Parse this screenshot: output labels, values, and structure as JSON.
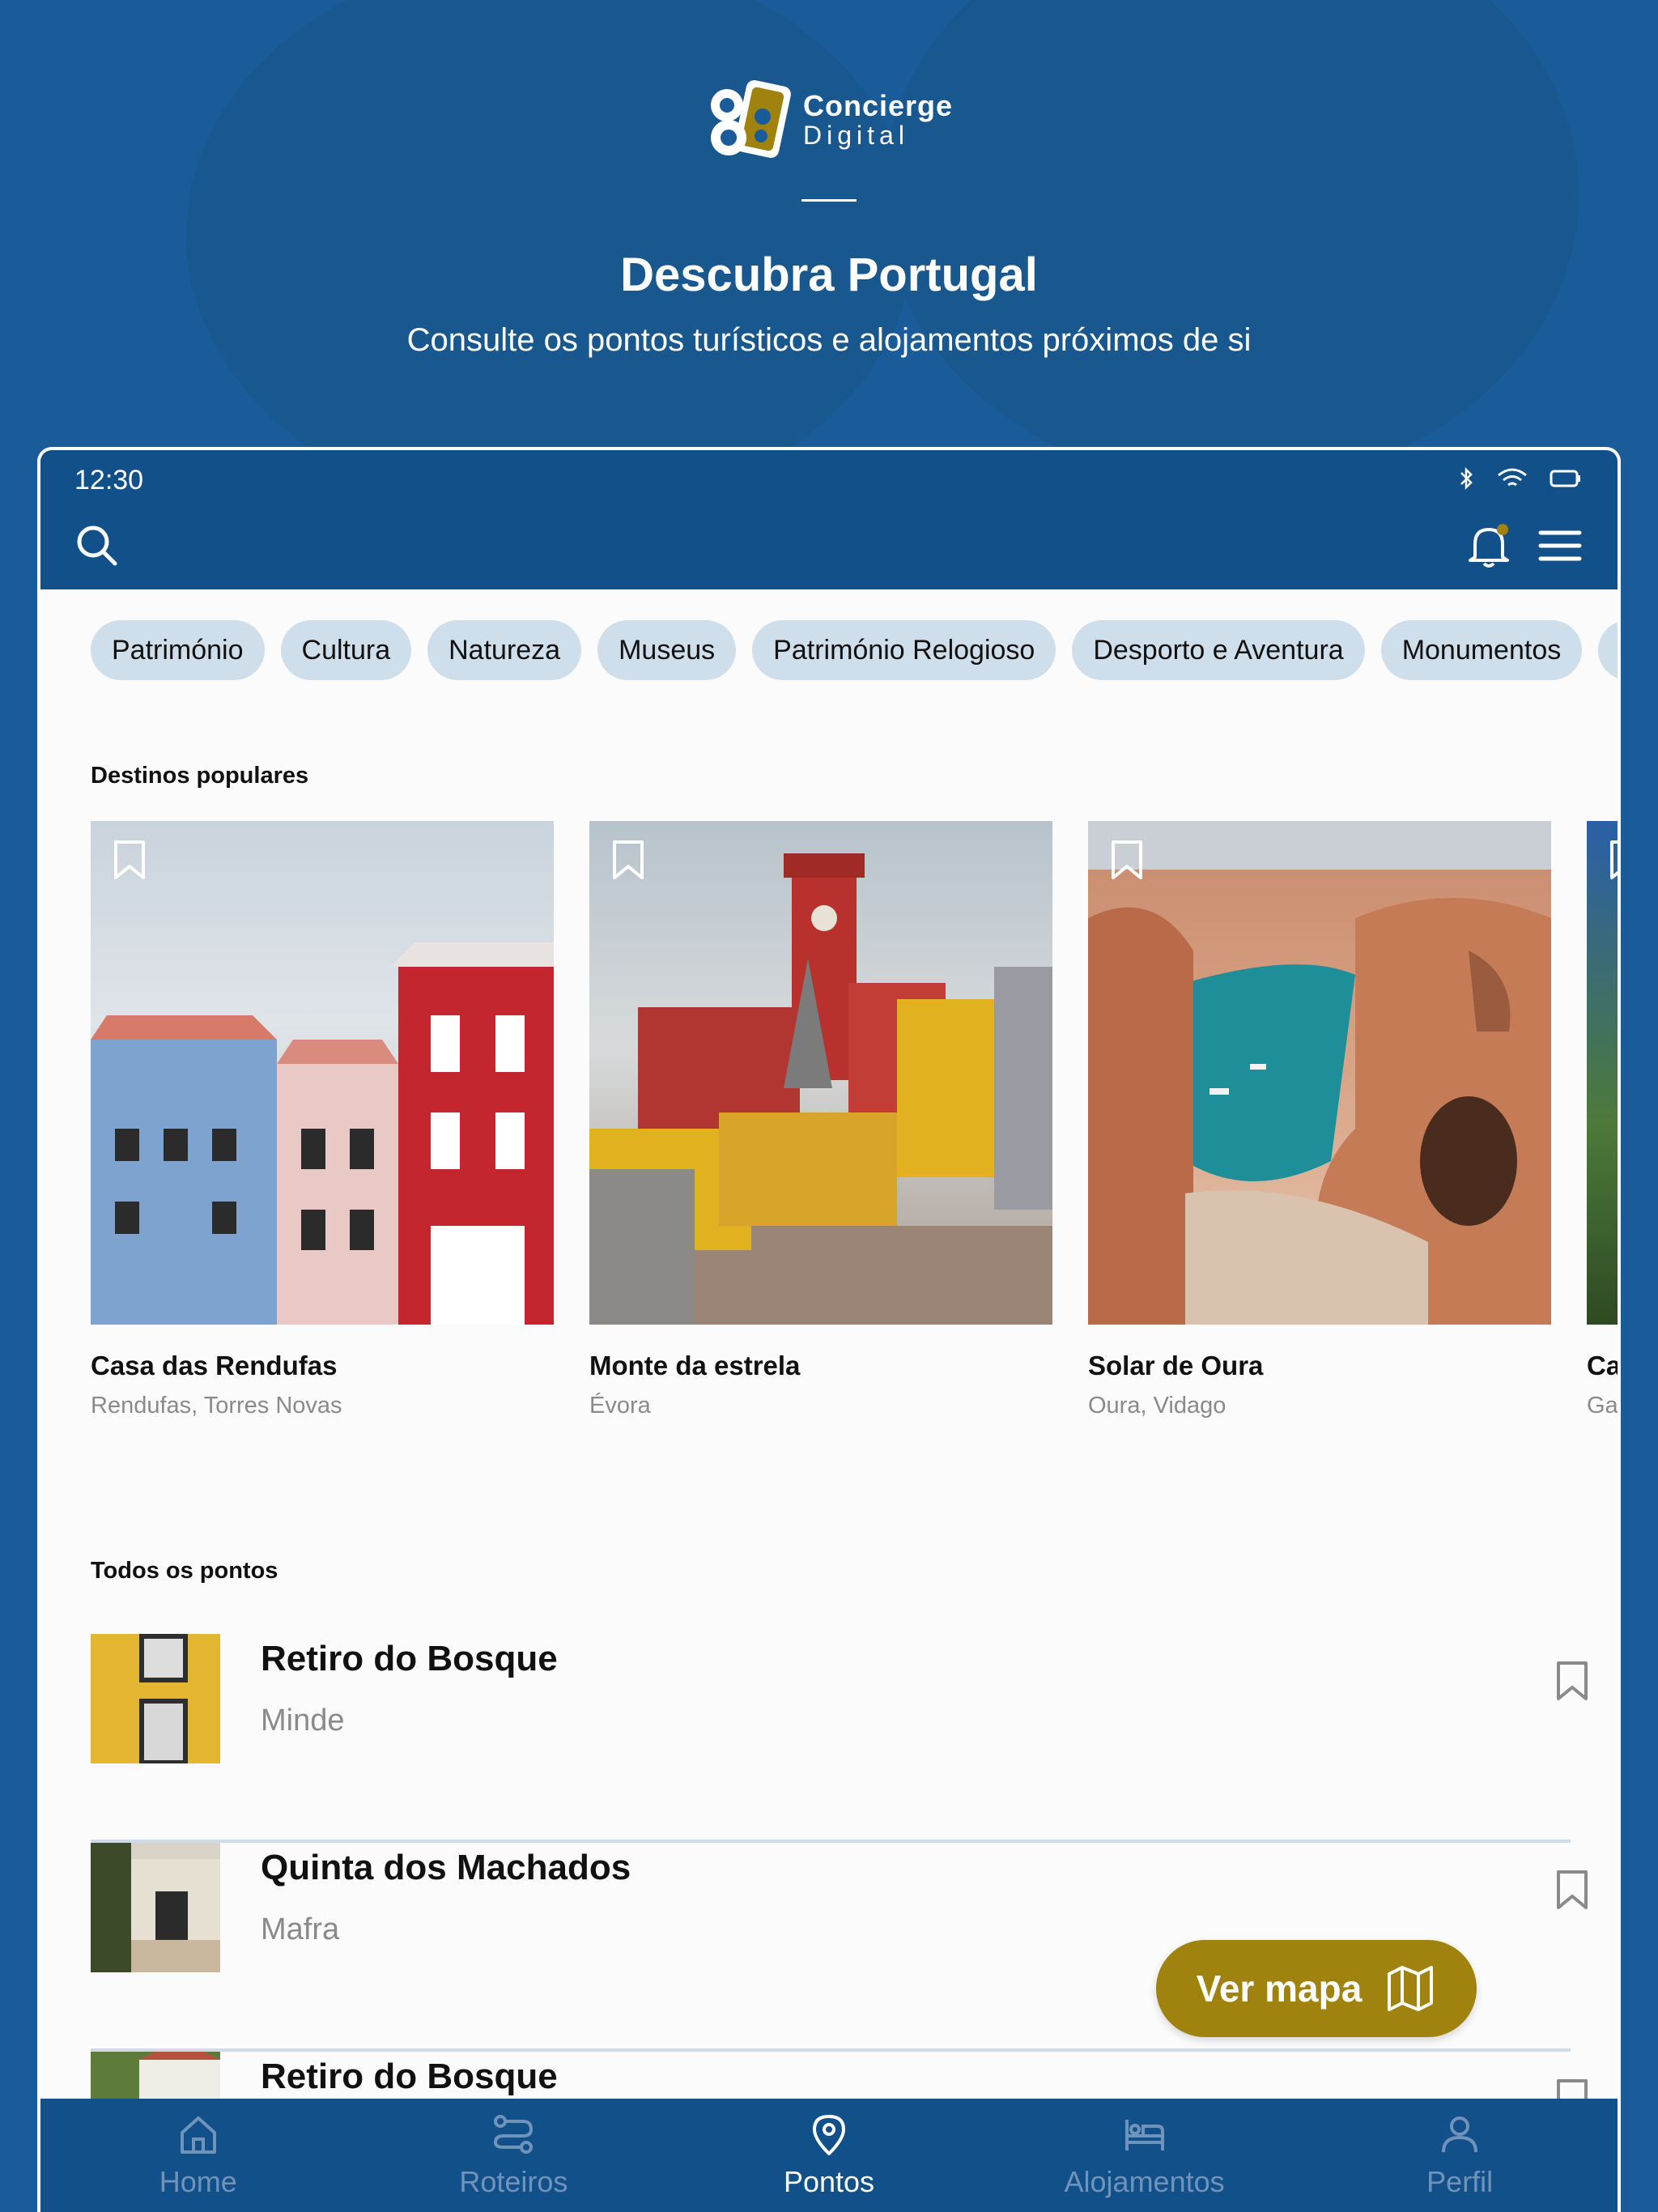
{
  "hero": {
    "brand_line1": "Concierge",
    "brand_line2": "Digital",
    "title": "Descubra Portugal",
    "subtitle": "Consulte os pontos turísticos e alojamentos próximos de si"
  },
  "status": {
    "time": "12:30"
  },
  "categories": [
    "Património",
    "Cultura",
    "Natureza",
    "Museus",
    "Património Relogioso",
    "Desporto e Aventura",
    "Monumentos",
    "C"
  ],
  "popular": {
    "title": "Destinos populares",
    "items": [
      {
        "name": "Casa das Rendufas",
        "location": "Rendufas, Torres Novas"
      },
      {
        "name": "Monte da estrela",
        "location": "Évora"
      },
      {
        "name": "Solar de Oura",
        "location": "Oura, Vidago"
      },
      {
        "name": "Ca",
        "location": "Ga"
      }
    ]
  },
  "all_points": {
    "title": "Todos os pontos",
    "items": [
      {
        "title": "Retiro do Bosque",
        "location": "Minde"
      },
      {
        "title": "Quinta dos Machados",
        "location": "Mafra"
      },
      {
        "title": "Retiro do Bosque",
        "location": ""
      }
    ]
  },
  "fab": {
    "label": "Ver mapa"
  },
  "nav": {
    "items": [
      {
        "label": "Home",
        "icon": "home-icon"
      },
      {
        "label": "Roteiros",
        "icon": "route-icon"
      },
      {
        "label": "Pontos",
        "icon": "map-pin-icon",
        "active": true
      },
      {
        "label": "Alojamentos",
        "icon": "bed-icon"
      },
      {
        "label": "Perfil",
        "icon": "user-icon"
      }
    ]
  },
  "colors": {
    "primary": "#12508a",
    "accent": "#a0820e",
    "chip": "#cfdeeb",
    "background": "#1a5c99"
  }
}
